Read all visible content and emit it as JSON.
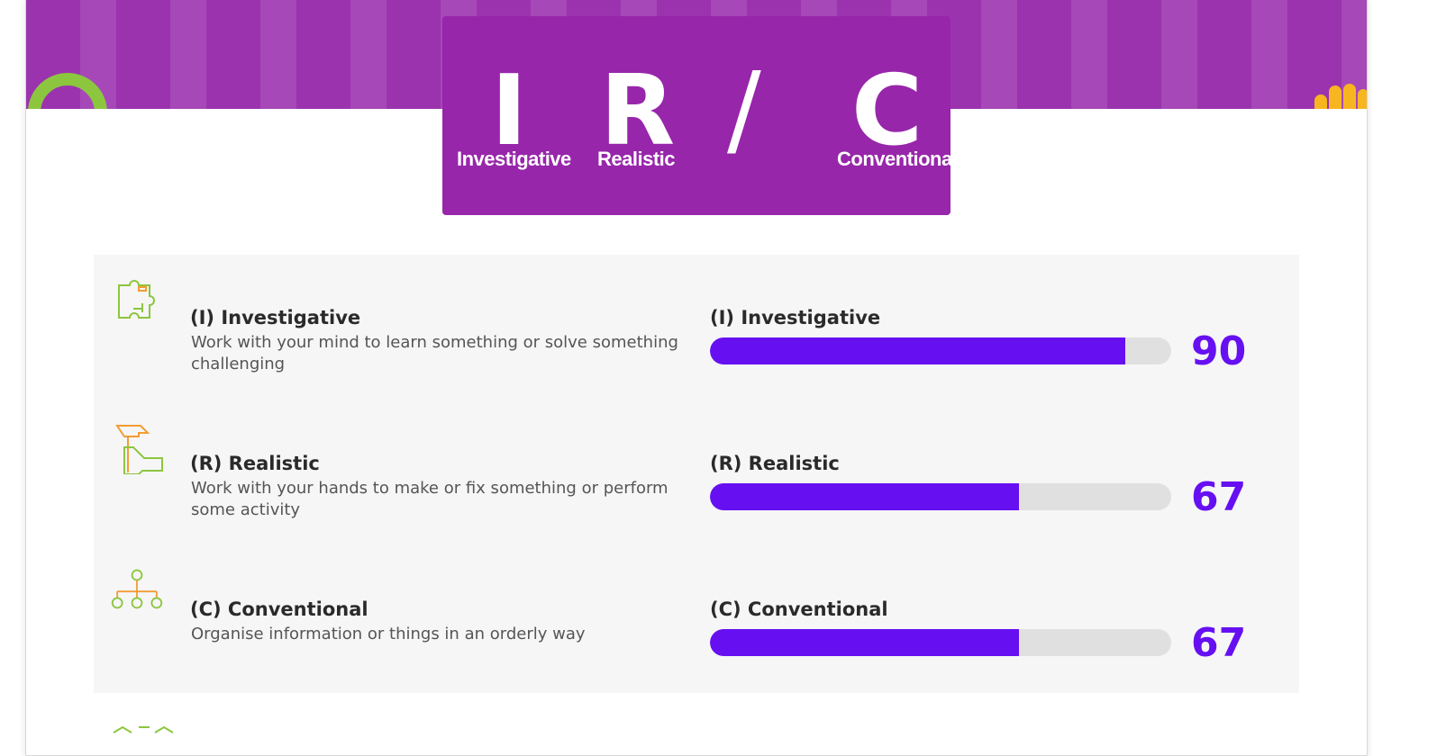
{
  "header": {
    "code_letters": [
      "I",
      "R",
      "/",
      "C"
    ],
    "code_labels": [
      "Investigative",
      "Realistic",
      "",
      "Conventional"
    ]
  },
  "interests": [
    {
      "title": "(I) Investigative",
      "description": "Work with your mind to learn something or solve something challenging",
      "bar_label": "(I) Investigative",
      "score": "90",
      "score_value": 90,
      "icon": "puzzle-icon"
    },
    {
      "title": "(R) Realistic",
      "description": "Work with your hands to make or fix something or perform some activity",
      "bar_label": "(R) Realistic",
      "score": "67",
      "score_value": 67,
      "icon": "hammer-hand-icon"
    },
    {
      "title": "(C) Conventional",
      "description": "Organise information or things in an orderly way",
      "bar_label": "(C) Conventional",
      "score": "67",
      "score_value": 67,
      "icon": "org-chart-icon"
    }
  ],
  "colors": {
    "banner": "#9b33ae",
    "code_box": "#9726aa",
    "bar_fill": "#6610f2",
    "bar_track": "#e0e0e0",
    "score": "#6610f2",
    "icon_green": "#8cc63f",
    "icon_orange": "#f39c34"
  }
}
